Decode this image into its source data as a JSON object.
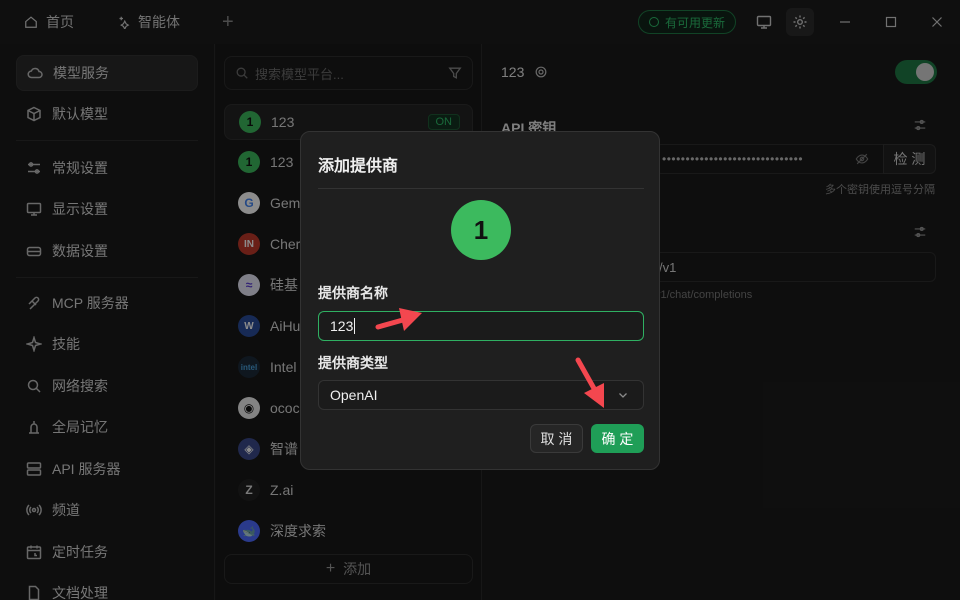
{
  "titlebar": {
    "tabs": [
      {
        "label": "首页",
        "icon": "home-icon"
      },
      {
        "label": "智能体",
        "icon": "sparkle-icon"
      }
    ],
    "update_label": "有可用更新"
  },
  "sidebar": {
    "items": [
      {
        "label": "模型服务",
        "icon": "cloud-icon",
        "active": true
      },
      {
        "label": "默认模型",
        "icon": "cube-icon"
      },
      {
        "label": "常规设置",
        "icon": "sliders-icon"
      },
      {
        "label": "显示设置",
        "icon": "monitor-icon"
      },
      {
        "label": "数据设置",
        "icon": "database-icon"
      },
      {
        "label": "MCP 服务器",
        "icon": "mcp-icon"
      },
      {
        "label": "技能",
        "icon": "sparkle-icon"
      },
      {
        "label": "网络搜索",
        "icon": "search-icon"
      },
      {
        "label": "全局记忆",
        "icon": "memory-icon"
      },
      {
        "label": "API 服务器",
        "icon": "server-icon"
      },
      {
        "label": "频道",
        "icon": "broadcast-icon"
      },
      {
        "label": "定时任务",
        "icon": "calendar-icon"
      },
      {
        "label": "文档处理",
        "icon": "document-icon"
      }
    ]
  },
  "provider_list": {
    "search_placeholder": "搜索模型平台...",
    "items": [
      {
        "label": "123",
        "avatar": "1",
        "color": "#3cba5e",
        "badge": "ON"
      },
      {
        "label": "123",
        "avatar": "1",
        "color": "#3cba5e"
      },
      {
        "label": "Gem",
        "avatar": "G",
        "color": "#ffffff"
      },
      {
        "label": "Cher",
        "avatar": "IN",
        "color": "#c0392b"
      },
      {
        "label": "硅基",
        "avatar": "≈",
        "color": "#e8e8f8"
      },
      {
        "label": "AiHu",
        "avatar": "W",
        "color": "#2a4d9c"
      },
      {
        "label": "Intel",
        "avatar": "intel",
        "color": "#1d2b3a"
      },
      {
        "label": "ococ",
        "avatar": "◉",
        "color": "#eeeeee"
      },
      {
        "label": "智谱",
        "avatar": "◈",
        "color": "#3b4a8a"
      },
      {
        "label": "Z.ai",
        "avatar": "Z",
        "color": "#222222"
      },
      {
        "label": "深度求索",
        "avatar": "🐋",
        "color": "#4d6bfe"
      }
    ],
    "add_label": "添加"
  },
  "detail": {
    "title": "123",
    "api_key_label": "API 密钥",
    "api_key_value": "••••••••••••••••••••••••••••••",
    "check_label": "检 测",
    "api_key_hint": "多个密钥使用逗号分隔",
    "url_value": "/v1",
    "url_hint": "v1/chat/completions"
  },
  "modal": {
    "title": "添加提供商",
    "avatar_text": "1",
    "name_label": "提供商名称",
    "name_value": "123",
    "type_label": "提供商类型",
    "type_value": "OpenAI",
    "cancel_label": "取 消",
    "ok_label": "确 定"
  },
  "colors": {
    "accent": "#1f9e57",
    "annotation_arrow": "#f4474f"
  }
}
